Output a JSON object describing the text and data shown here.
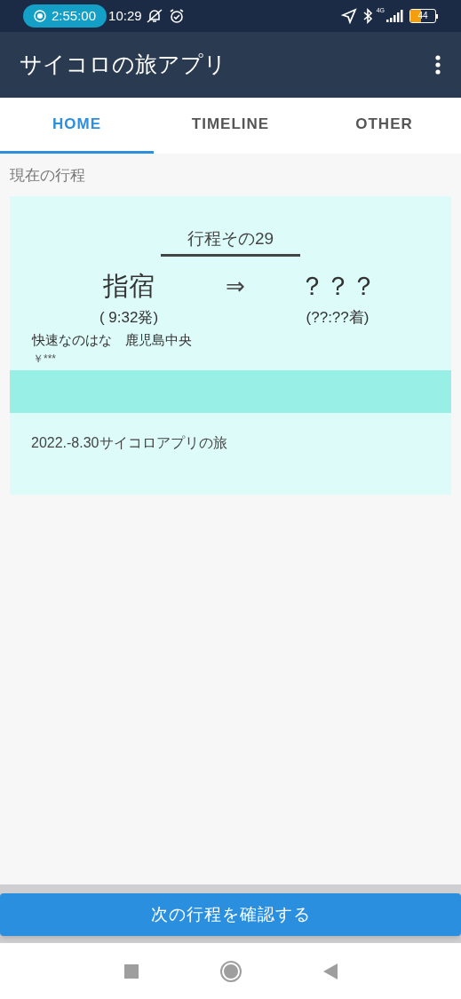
{
  "status_bar": {
    "recording": "2:55:00",
    "time": "10:29",
    "network": "4G",
    "battery": "44"
  },
  "app_bar": {
    "title": "サイコロの旅アプリ"
  },
  "tabs": [
    {
      "label": "HOME",
      "selected": true
    },
    {
      "label": "TIMELINE",
      "selected": false
    },
    {
      "label": "OTHER",
      "selected": false
    }
  ],
  "section_label": "現在の行程",
  "trip_card": {
    "title": "行程その29",
    "from": "指宿",
    "arrow": "⇒",
    "to": "？？？",
    "departure": "( 9:32発)",
    "arrival": "(??:??着)",
    "train": "快速なのはな　鹿児島中央",
    "fare": "￥***",
    "note": "2022.-8.30サイコロアプリの旅"
  },
  "next_button": "次の行程を確認する"
}
